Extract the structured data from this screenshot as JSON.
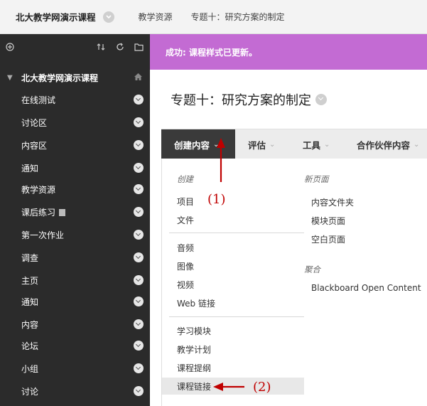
{
  "breadcrumb": {
    "course": "北大教学网演示课程",
    "item1": "教学资源",
    "item2": "专题十：研究方案的制定"
  },
  "sidebar": {
    "course_name": "北大教学网演示课程",
    "items": [
      {
        "label": "在线测试"
      },
      {
        "label": "讨论区"
      },
      {
        "label": "内容区"
      },
      {
        "label": "通知"
      },
      {
        "label": "教学资源"
      },
      {
        "label": "课后练习"
      },
      {
        "label": "第一次作业"
      },
      {
        "label": "调查"
      },
      {
        "label": "主页"
      },
      {
        "label": "通知"
      },
      {
        "label": "内容"
      },
      {
        "label": "论坛"
      },
      {
        "label": "小组"
      },
      {
        "label": "讨论"
      }
    ]
  },
  "success_message": "成功: 课程样式已更新。",
  "page_title": "专题十：研究方案的制定",
  "action_bar": {
    "create": "创建内容",
    "assess": "评估",
    "tools": "工具",
    "partner": "合作伙伴内容"
  },
  "dropdown": {
    "create_heading": "创建",
    "create_items": [
      "项目",
      "文件"
    ],
    "media_items": [
      "音频",
      "图像",
      "视频",
      "Web 链接"
    ],
    "module_items": [
      "学习模块",
      "教学计划",
      "课程提纲",
      "课程链接"
    ],
    "new_page_heading": "新页面",
    "new_page_items": [
      "内容文件夹",
      "模块页面",
      "空白页面"
    ],
    "mashup_heading": "聚合",
    "mashup_items": [
      "Blackboard Open Content"
    ]
  },
  "annotations": {
    "label1": "(1)",
    "label2": "(2)"
  },
  "colors": {
    "sidebar_bg": "#2b2b2b",
    "success_bg": "#c36bd3",
    "annotation": "#c00000"
  }
}
